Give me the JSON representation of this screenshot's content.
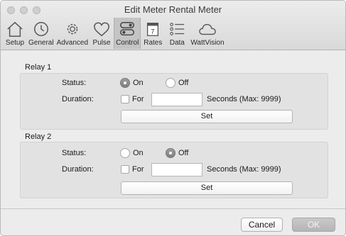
{
  "window": {
    "title": "Edit Meter Rental Meter"
  },
  "toolbar": {
    "items": [
      {
        "label": "Setup",
        "icon": "house-icon"
      },
      {
        "label": "General",
        "icon": "clock-icon"
      },
      {
        "label": "Advanced",
        "icon": "gear-icon"
      },
      {
        "label": "Pulse",
        "icon": "heart-icon"
      },
      {
        "label": "Control",
        "icon": "toggle-switches-icon"
      },
      {
        "label": "Rates",
        "icon": "calendar-icon"
      },
      {
        "label": "Data",
        "icon": "list-icon"
      },
      {
        "label": "WattVision",
        "icon": "cloud-icon"
      }
    ],
    "active": "Control",
    "calendar_day": "7"
  },
  "relay1": {
    "title": "Relay 1",
    "status_label": "Status:",
    "on_label": "On",
    "off_label": "Off",
    "status_selected": "On",
    "duration_label": "Duration:",
    "for_label": "For",
    "for_checked": false,
    "duration_value": "",
    "seconds_label": "Seconds (Max: 9999)",
    "set_label": "Set"
  },
  "relay2": {
    "title": "Relay 2",
    "status_label": "Status:",
    "on_label": "On",
    "off_label": "Off",
    "status_selected": "Off",
    "duration_label": "Duration:",
    "for_label": "For",
    "for_checked": false,
    "duration_value": "",
    "seconds_label": "Seconds (Max: 9999)",
    "set_label": "Set"
  },
  "footer": {
    "cancel_label": "Cancel",
    "ok_label": "OK"
  }
}
